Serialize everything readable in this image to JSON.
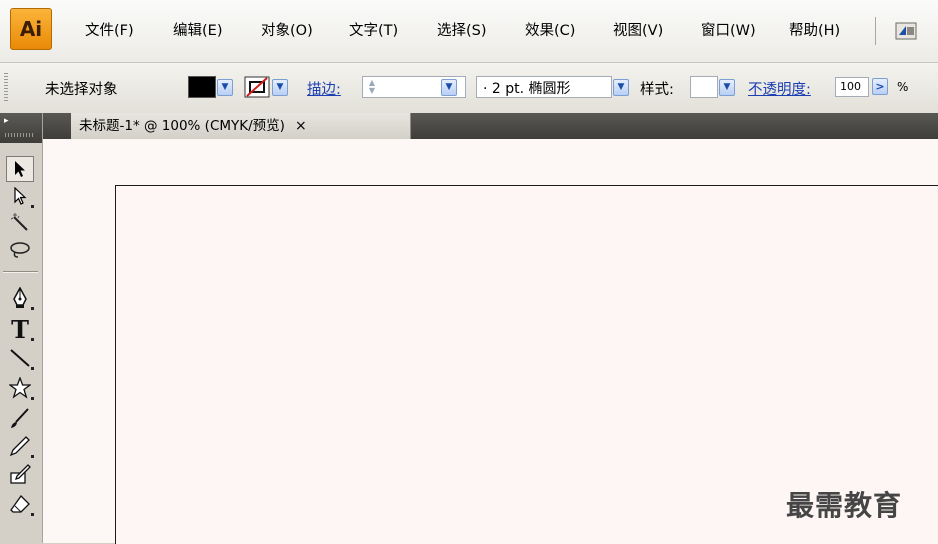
{
  "app": {
    "logo": "Ai",
    "menu": [
      "文件(F)",
      "编辑(E)",
      "对象(O)",
      "文字(T)",
      "选择(S)",
      "效果(C)",
      "视图(V)",
      "窗口(W)",
      "帮助(H)"
    ],
    "bridge_icon": "bridge-icon"
  },
  "control_bar": {
    "selection_status": "未选择对象",
    "fill_color": "#000000",
    "stroke_color": "none",
    "stroke_label": "描边:",
    "stroke_weight": "",
    "brush": "· 2 pt. 椭圆形",
    "style_label": "样式:",
    "opacity_label": "不透明度:",
    "opacity_value": "100",
    "opacity_unit": "%"
  },
  "document": {
    "tab_title": "未标题-1* @ 100% (CMYK/预览)",
    "close_glyph": "×"
  },
  "tools": [
    "selection-tool-icon",
    "direct-selection-tool-icon",
    "magic-wand-tool-icon",
    "lasso-tool-icon",
    "pen-tool-icon",
    "type-tool-icon",
    "line-segment-tool-icon",
    "star-tool-icon",
    "paintbrush-tool-icon",
    "pencil-tool-icon",
    "blob-brush-tool-icon",
    "eraser-tool-icon"
  ],
  "watermark": "最需教育",
  "colors": {
    "canvas": "#fdf6f5",
    "accent_link": "#1c3fb3",
    "logo_orange": "#f39c12"
  }
}
